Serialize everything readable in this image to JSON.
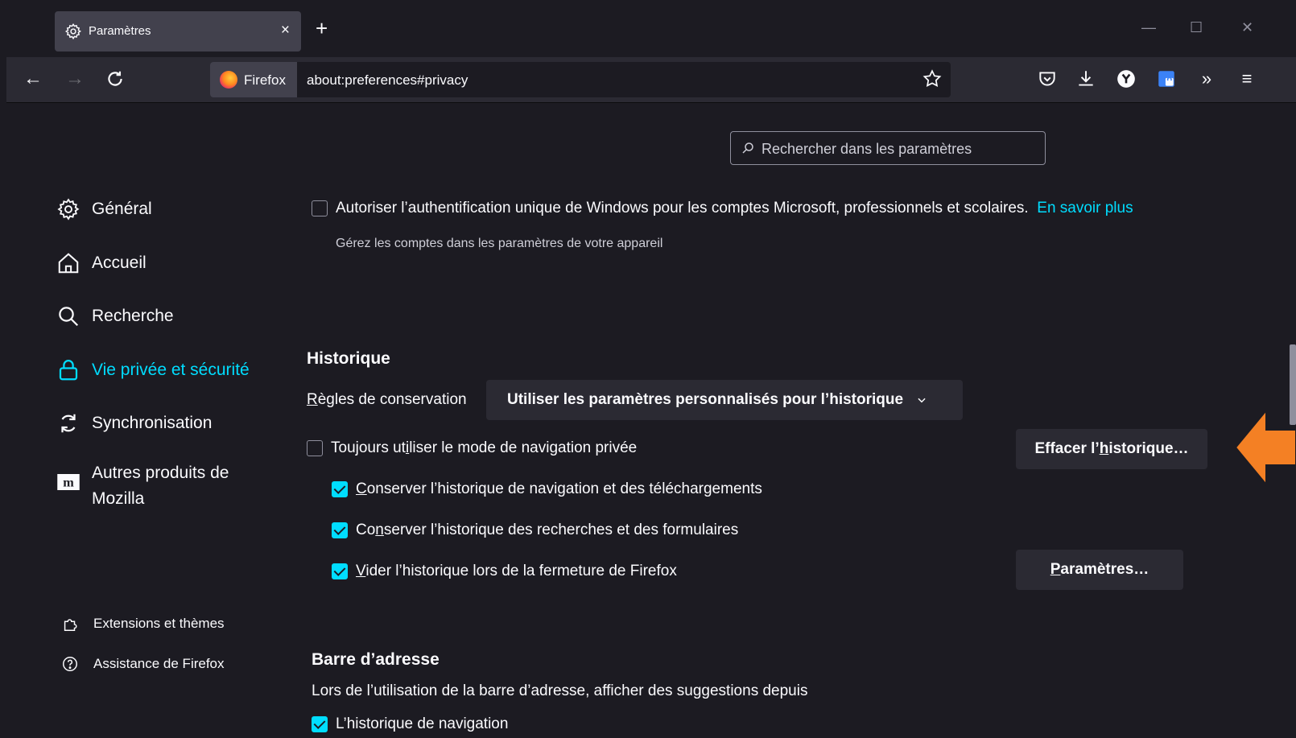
{
  "tab": {
    "title": "Paramètres",
    "close": "×"
  },
  "new_tab": "+",
  "window_controls": {
    "minimize": "—",
    "maximize": "☐",
    "close": "✕"
  },
  "nav": {
    "back": "←",
    "forward": "→",
    "identity_label": "Firefox",
    "url": "about:preferences#privacy",
    "overflow": "»",
    "menu": "≡"
  },
  "search": {
    "placeholder": "Rechercher dans les paramètres"
  },
  "sidebar": {
    "items": [
      {
        "label": "Général",
        "icon": "gear-icon"
      },
      {
        "label": "Accueil",
        "icon": "home-icon"
      },
      {
        "label": "Recherche",
        "icon": "search-icon"
      },
      {
        "label": "Vie privée et sécurité",
        "icon": "lock-icon",
        "active": true
      },
      {
        "label": "Synchronisation",
        "icon": "sync-icon"
      },
      {
        "label": "Autres produits de Mozilla",
        "icon": "mozilla-icon"
      }
    ],
    "footer": [
      {
        "label": "Extensions et thèmes",
        "icon": "puzzle-icon"
      },
      {
        "label": "Assistance de Firefox",
        "icon": "help-icon"
      }
    ]
  },
  "sso": {
    "label": "Autoriser l’authentification unique de Windows pour les comptes Microsoft, professionnels et scolaires.",
    "link": "En savoir plus",
    "hint": "Gérez les comptes dans les paramètres de votre appareil",
    "checked": false
  },
  "history": {
    "heading": "Historique",
    "rules_label_first": "R",
    "rules_label_rest": "ègles de conservation",
    "rules_value": "Utiliser les paramètres personnalisés pour l’historique",
    "private_pre": "Toujours ut",
    "private_ul": "i",
    "private_post": "liser le mode de navigation privée",
    "clear_pre": "Effacer l’",
    "clear_ul": "h",
    "clear_post": "istorique…",
    "keep_nav_ul": "C",
    "keep_nav_rest": "onserver l’historique de navigation et des téléchargements",
    "keep_search_pre": "Co",
    "keep_search_ul": "n",
    "keep_search_post": "server l’historique des recherches et des formulaires",
    "clear_on_close_ul": "V",
    "clear_on_close_rest": "ider l’historique lors de la fermeture de Firefox",
    "settings_ul": "P",
    "settings_rest": "aramètres…"
  },
  "address_bar": {
    "heading": "Barre d’adresse",
    "desc": "Lors de l’utilisation de la barre d’adresse, afficher des suggestions depuis",
    "first_option": "L’historique de navigation"
  },
  "colors": {
    "accent": "#00ddff",
    "arrow": "#f48024",
    "background": "#1c1b22",
    "button": "#2b2a33"
  }
}
